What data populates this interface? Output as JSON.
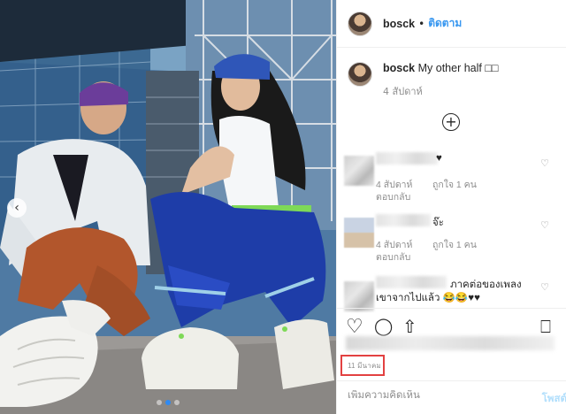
{
  "post": {
    "username": "bosck",
    "follow_separator": "•",
    "follow_label": "ติดตาม",
    "caption_text": "My other half ",
    "caption_emoji": "□□",
    "caption_time": "4 สัปดาห์",
    "carousel_prev_label": "‹",
    "load_more_label": "+"
  },
  "comments": [
    {
      "text": "♥",
      "time": "4 สัปดาห์",
      "likes": "ถูกใจ 1 คน",
      "reply": "ตอบกลับ"
    },
    {
      "text": "จ๊ะ",
      "time": "4 สัปดาห์",
      "likes": "ถูกใจ 1 คน",
      "reply": "ตอบกลับ"
    },
    {
      "text": "ภาคต่อของเพลง",
      "text2": "เขาจากไปแล้ว 😂😂♥♥"
    }
  ],
  "actions": {
    "like_icon": "♡",
    "comment_icon": "◯",
    "share_icon": "⇧",
    "save_icon": "⎕"
  },
  "date_label": "11 มีนาคม",
  "add_comment": {
    "placeholder": "เพิ่มความคิดเห็น",
    "post_label": "โพสต์"
  }
}
